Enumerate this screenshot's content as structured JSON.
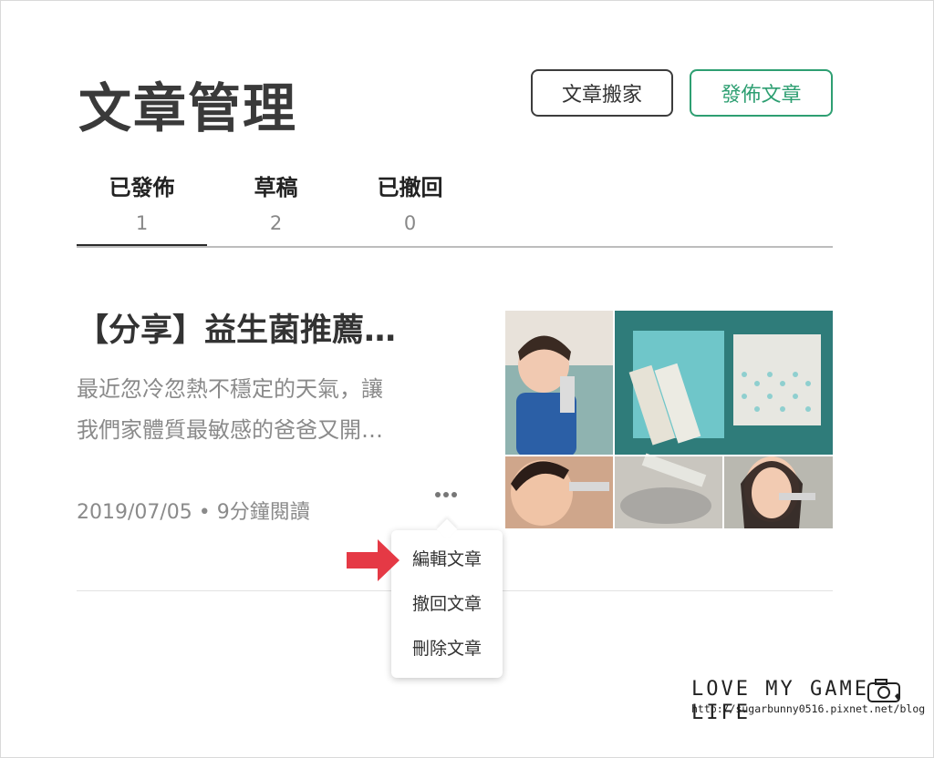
{
  "header": {
    "title": "文章管理",
    "migrate_label": "文章搬家",
    "publish_label": "發佈文章"
  },
  "tabs": [
    {
      "label": "已發佈",
      "count": "1",
      "active": true
    },
    {
      "label": "草稿",
      "count": "2",
      "active": false
    },
    {
      "label": "已撤回",
      "count": "0",
      "active": false
    }
  ],
  "post": {
    "title": "【分享】益生菌推薦…",
    "excerpt_line1": "最近忽冷忽熱不穩定的天氣，讓",
    "excerpt_line2": "我們家體質最敏感的爸爸又開…",
    "meta": "2019/07/05 • 9分鐘閱讀"
  },
  "menu": {
    "items": [
      "編輯文章",
      "撤回文章",
      "刪除文章"
    ]
  },
  "watermark": {
    "title": "LOVE MY GAME LIFE",
    "url": "http://sugarbunny0516.pixnet.net/blog"
  },
  "colors": {
    "accent": "#2e9f72",
    "arrow": "#e53945",
    "thumbnail_bg": "#2f6f6e"
  },
  "icons": [
    "more-dots-icon",
    "red-arrow-icon",
    "camera-icon"
  ]
}
